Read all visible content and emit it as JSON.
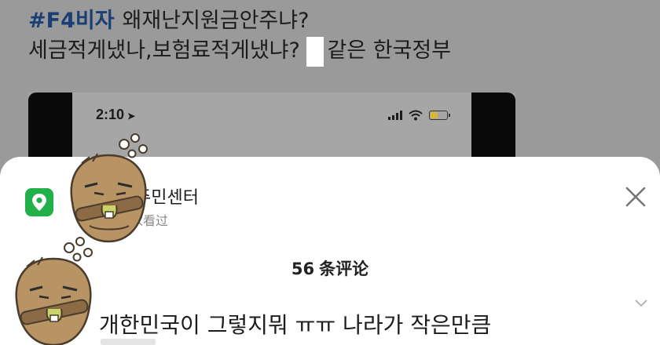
{
  "post": {
    "hashtag": "#F4비자",
    "line1_text": "왜재난지원금안주냐?",
    "line2_before": "세금적게냈나,보험료적게냈냐?",
    "line2_after": "같은 한국정부"
  },
  "phone_status": {
    "time": "2:10",
    "location_glyph": "➤",
    "battery_level": 0.45
  },
  "sheet": {
    "app_name_visible": "주민센터",
    "app_subtitle_visible": "家看过",
    "comment_count_number": "56",
    "comment_count_label": "条评论",
    "first_comment": "개한민국이 그렇지뭐 ㅠㅠ 나라가 작은만큼"
  },
  "colors": {
    "hashtag": "#1a3f74",
    "app_icon": "#22b04b",
    "dim_overlay": "#9a9a9a",
    "battery": "#d9b63a"
  },
  "icons": {
    "app_icon": "location-pin-icon",
    "close": "close-icon",
    "expand": "chevron-down-icon",
    "signal": "cellular-signal-icon",
    "wifi": "wifi-icon",
    "battery": "battery-icon",
    "sticker": "sweating-hamster-sticker"
  }
}
